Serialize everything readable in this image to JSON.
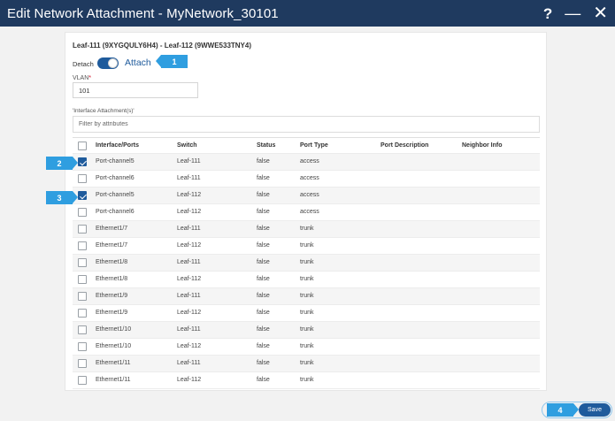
{
  "window": {
    "title": "Edit Network Attachment - MyNetwork_30101",
    "help_icon": "?",
    "minimize_icon": "—",
    "close_icon": "✕"
  },
  "panel": {
    "switch_title": "Leaf-111 (9XYGQULY6H4) - Leaf-112 (9WWE533TNY4)",
    "detach_label": "Detach",
    "attach_label": "Attach",
    "vlan_label": "VLAN",
    "vlan_required": "*",
    "vlan_value": "101",
    "interface_label": "'Interface Attachment(s)'",
    "filter_placeholder": "Filter by attributes"
  },
  "table": {
    "headers": {
      "iface": "Interface/Ports",
      "switch": "Switch",
      "status": "Status",
      "type": "Port Type",
      "desc": "Port Description",
      "nbr": "Neighbor Info"
    },
    "rows": [
      {
        "iface": "Port-channel5",
        "switch": "Leaf-111",
        "status": "false",
        "type": "access",
        "checked": true
      },
      {
        "iface": "Port-channel6",
        "switch": "Leaf-111",
        "status": "false",
        "type": "access",
        "checked": false
      },
      {
        "iface": "Port-channel5",
        "switch": "Leaf-112",
        "status": "false",
        "type": "access",
        "checked": true
      },
      {
        "iface": "Port-channel6",
        "switch": "Leaf-112",
        "status": "false",
        "type": "access",
        "checked": false
      },
      {
        "iface": "Ethernet1/7",
        "switch": "Leaf-111",
        "status": "false",
        "type": "trunk",
        "checked": false
      },
      {
        "iface": "Ethernet1/7",
        "switch": "Leaf-112",
        "status": "false",
        "type": "trunk",
        "checked": false
      },
      {
        "iface": "Ethernet1/8",
        "switch": "Leaf-111",
        "status": "false",
        "type": "trunk",
        "checked": false
      },
      {
        "iface": "Ethernet1/8",
        "switch": "Leaf-112",
        "status": "false",
        "type": "trunk",
        "checked": false
      },
      {
        "iface": "Ethernet1/9",
        "switch": "Leaf-111",
        "status": "false",
        "type": "trunk",
        "checked": false
      },
      {
        "iface": "Ethernet1/9",
        "switch": "Leaf-112",
        "status": "false",
        "type": "trunk",
        "checked": false
      },
      {
        "iface": "Ethernet1/10",
        "switch": "Leaf-111",
        "status": "false",
        "type": "trunk",
        "checked": false
      },
      {
        "iface": "Ethernet1/10",
        "switch": "Leaf-112",
        "status": "false",
        "type": "trunk",
        "checked": false
      },
      {
        "iface": "Ethernet1/11",
        "switch": "Leaf-111",
        "status": "false",
        "type": "trunk",
        "checked": false
      },
      {
        "iface": "Ethernet1/11",
        "switch": "Leaf-112",
        "status": "false",
        "type": "trunk",
        "checked": false
      }
    ]
  },
  "callouts": {
    "c1": "1",
    "c2": "2",
    "c3": "3",
    "c4": "4"
  },
  "footer": {
    "save_label": "Save"
  },
  "colors": {
    "titlebar": "#1f3a5f",
    "accent": "#1f5b9c",
    "callout": "#2f9ee0"
  }
}
